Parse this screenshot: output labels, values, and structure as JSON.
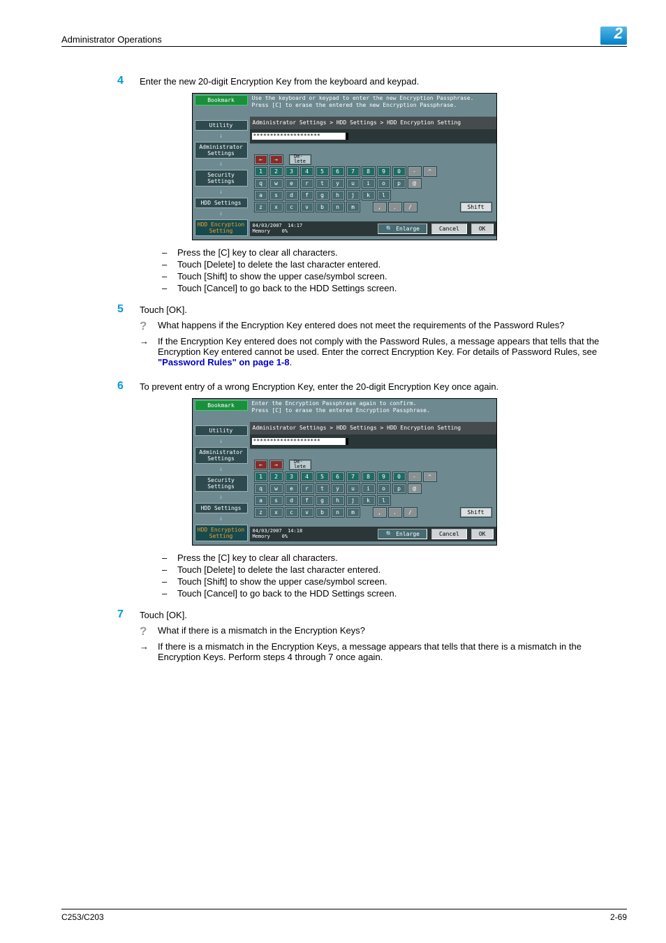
{
  "header": {
    "title": "Administrator Operations",
    "chapter": "2"
  },
  "footer": {
    "model": "C253/C203",
    "page": "2-69"
  },
  "steps": {
    "s4": {
      "num": "4",
      "text": "Enter the new 20-digit Encryption Key from the keyboard and keypad."
    },
    "s5": {
      "num": "5",
      "text": "Touch [OK]."
    },
    "s6": {
      "num": "6",
      "text": "To prevent entry of a wrong Encryption Key, enter the 20-digit Encryption Key once again."
    },
    "s7": {
      "num": "7",
      "text": "Touch [OK]."
    }
  },
  "notes_a": {
    "i1": "Press the [C] key to clear all characters.",
    "i2": "Touch [Delete] to delete the last character entered.",
    "i3": "Touch [Shift] to show the upper case/symbol screen.",
    "i4": "Touch [Cancel] to go back to the HDD Settings screen."
  },
  "qa5": {
    "q": "What happens if the Encryption Key entered does not meet the requirements of the Password Rules?",
    "a_pre": "If the Encryption Key entered does not comply with the Password Rules, a message appears that tells that the Encryption Key entered cannot be used. Enter the correct Encryption Key. For details of Password Rules, see ",
    "a_link": "\"Password Rules\" on page 1-8",
    "a_post": "."
  },
  "qa7": {
    "q": "What if there is a mismatch in the Encryption Keys?",
    "a": "If there is a mismatch in the Encryption Keys, a message appears that tells that there is a mismatch in the Encryption Keys. Perform steps 4 through 7 once again."
  },
  "panel": {
    "instr1_l1": "Use the keyboard or keypad to enter the new Encryption Passphrase.",
    "instr1_l2": "Press [C] to erase the entered the new Encryption Passphrase.",
    "instr2_l1": "Enter the Encryption Passphrase again to confirm.",
    "instr2_l2": "Press [C] to erase the entered Encryption Passphrase.",
    "breadcrumb": "Administrator Settings > HDD Settings > HDD Encryption Setting",
    "input_value": "********************",
    "side": {
      "bookmark": "Bookmark",
      "utility": "Utility",
      "admin": "Administrator Settings",
      "security": "Security Settings",
      "hdd": "HDD Settings",
      "enc": "HDD Encryption Setting"
    },
    "delete": "De-\nlete",
    "shift": "Shift",
    "row_num": [
      "1",
      "2",
      "3",
      "4",
      "5",
      "6",
      "7",
      "8",
      "9",
      "0",
      "-",
      "^"
    ],
    "row_q": [
      "q",
      "w",
      "e",
      "r",
      "t",
      "y",
      "u",
      "i",
      "o",
      "p",
      "@"
    ],
    "row_a": [
      "a",
      "s",
      "d",
      "f",
      "g",
      "h",
      "j",
      "k",
      "l"
    ],
    "row_z": [
      "z",
      "x",
      "c",
      "v",
      "b",
      "n",
      "m",
      ",",
      ".",
      "/"
    ],
    "foot1": {
      "date": "04/03/2007",
      "time": "14:17",
      "mem": "Memory",
      "pct": "0%"
    },
    "foot2": {
      "date": "04/03/2007",
      "time": "14:18",
      "mem": "Memory",
      "pct": "0%"
    },
    "enlarge": "Enlarge",
    "cancel": "Cancel",
    "ok": "OK"
  }
}
